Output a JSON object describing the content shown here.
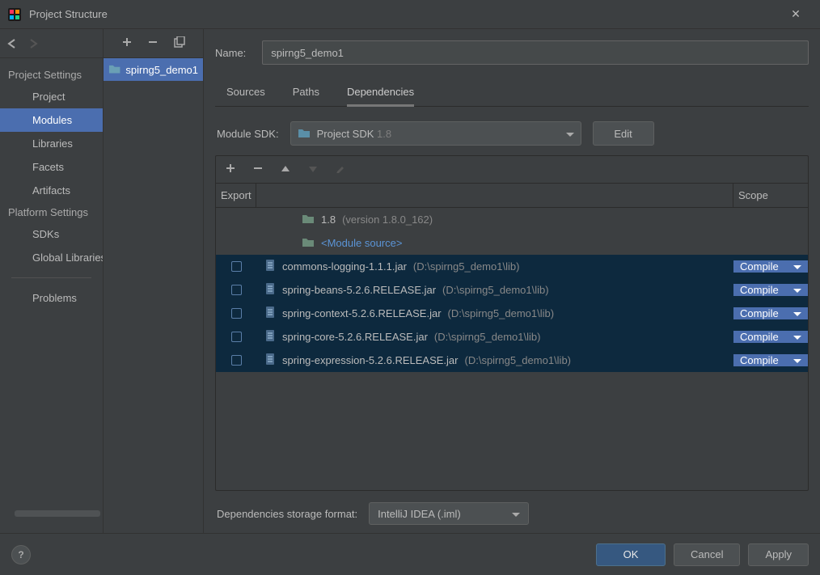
{
  "window": {
    "title": "Project Structure"
  },
  "sidebar": {
    "section1_title": "Project Settings",
    "section2_title": "Platform Settings",
    "items1": [
      "Project",
      "Modules",
      "Libraries",
      "Facets",
      "Artifacts"
    ],
    "items2": [
      "SDKs",
      "Global Libraries"
    ],
    "problems": "Problems",
    "selected_index": 1
  },
  "modulelist": {
    "selected": "spirng5_demo1"
  },
  "form": {
    "name_label": "Name:",
    "name_value": "spirng5_demo1",
    "tabs": [
      "Sources",
      "Paths",
      "Dependencies"
    ],
    "tab_selected": 2,
    "sdk_label": "Module SDK:",
    "sdk_prefix": "Project SDK ",
    "sdk_version": "1.8",
    "edit": "Edit",
    "header_export": "Export",
    "header_scope": "Scope",
    "deps": [
      {
        "type": "sdk",
        "name": "1.8",
        "suffix": "(version 1.8.0_162)"
      },
      {
        "type": "src",
        "name": "<Module source>"
      },
      {
        "type": "jar",
        "name": "commons-logging-1.1.1.jar",
        "loc": "(D:\\spirng5_demo1\\lib)",
        "scope": "Compile",
        "sel": true
      },
      {
        "type": "jar",
        "name": "spring-beans-5.2.6.RELEASE.jar",
        "loc": "(D:\\spirng5_demo1\\lib)",
        "scope": "Compile",
        "sel": true
      },
      {
        "type": "jar",
        "name": "spring-context-5.2.6.RELEASE.jar",
        "loc": "(D:\\spirng5_demo1\\lib)",
        "scope": "Compile",
        "sel": true
      },
      {
        "type": "jar",
        "name": "spring-core-5.2.6.RELEASE.jar",
        "loc": "(D:\\spirng5_demo1\\lib)",
        "scope": "Compile",
        "sel": true
      },
      {
        "type": "jar",
        "name": "spring-expression-5.2.6.RELEASE.jar",
        "loc": "(D:\\spirng5_demo1\\lib)",
        "scope": "Compile",
        "sel": true
      }
    ],
    "storage_label": "Dependencies storage format:",
    "storage_value": "IntelliJ IDEA (.iml)"
  },
  "footer": {
    "ok": "OK",
    "cancel": "Cancel",
    "apply": "Apply"
  }
}
